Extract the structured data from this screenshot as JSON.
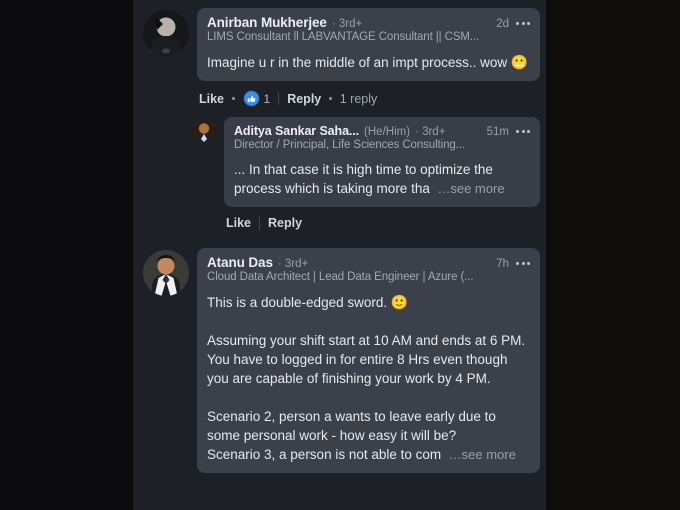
{
  "feed": {
    "comments": [
      {
        "id": "comment-1",
        "level": 1,
        "author": "Anirban Mukherjee",
        "degree": "· 3rd+",
        "pronoun": "",
        "time": "2d",
        "subtitle": "LIMS Consultant ll LABVANTAGE Consultant || CSM...",
        "body": "Imagine u r in the middle of an impt process.. wow",
        "body_emoji": "😬",
        "see_more": "",
        "actions": {
          "like_label": "Like",
          "reply_label": "Reply",
          "reaction_icon": "thumbs-up-icon",
          "reaction_count": "1",
          "replies_label": "1 reply"
        }
      },
      {
        "id": "comment-2",
        "level": 2,
        "author": "Aditya Sankar Saha...",
        "degree": "· 3rd+",
        "pronoun": "(He/Him)",
        "time": "51m",
        "subtitle": "Director / Principal, Life Sciences Consulting...",
        "body": "... In that case it is high time to optimize the process which is taking more tha",
        "body_emoji": "",
        "see_more": "…see more",
        "actions": {
          "like_label": "Like",
          "reply_label": "Reply",
          "reaction_icon": "",
          "reaction_count": "",
          "replies_label": ""
        }
      },
      {
        "id": "comment-3",
        "level": 1,
        "author": "Atanu Das",
        "degree": "· 3rd+",
        "pronoun": "",
        "time": "7h",
        "subtitle": "Cloud Data Architect | Lead Data Engineer | Azure (...",
        "body_line1": "This is a double-edged sword.",
        "body_emoji": "🙂",
        "body_para2": "Assuming your shift start at 10 AM and ends at 6 PM. You have to logged in for entire 8 Hrs even though you are capable of finishing your work by 4 PM.",
        "body_para3": "Scenario 2, person a wants to leave early due to some personal work - how easy it will be?",
        "body_para4": "Scenario 3, a person is not able to com",
        "see_more": "…see more"
      }
    ]
  },
  "colors": {
    "page_background": "#1d2026",
    "bubble_background": "#3b404b",
    "letterbox": "#0d0d0f",
    "primary_text": "#e6e9ee",
    "muted_text": "#a2a8b3",
    "like_blue": "#378fe9"
  }
}
